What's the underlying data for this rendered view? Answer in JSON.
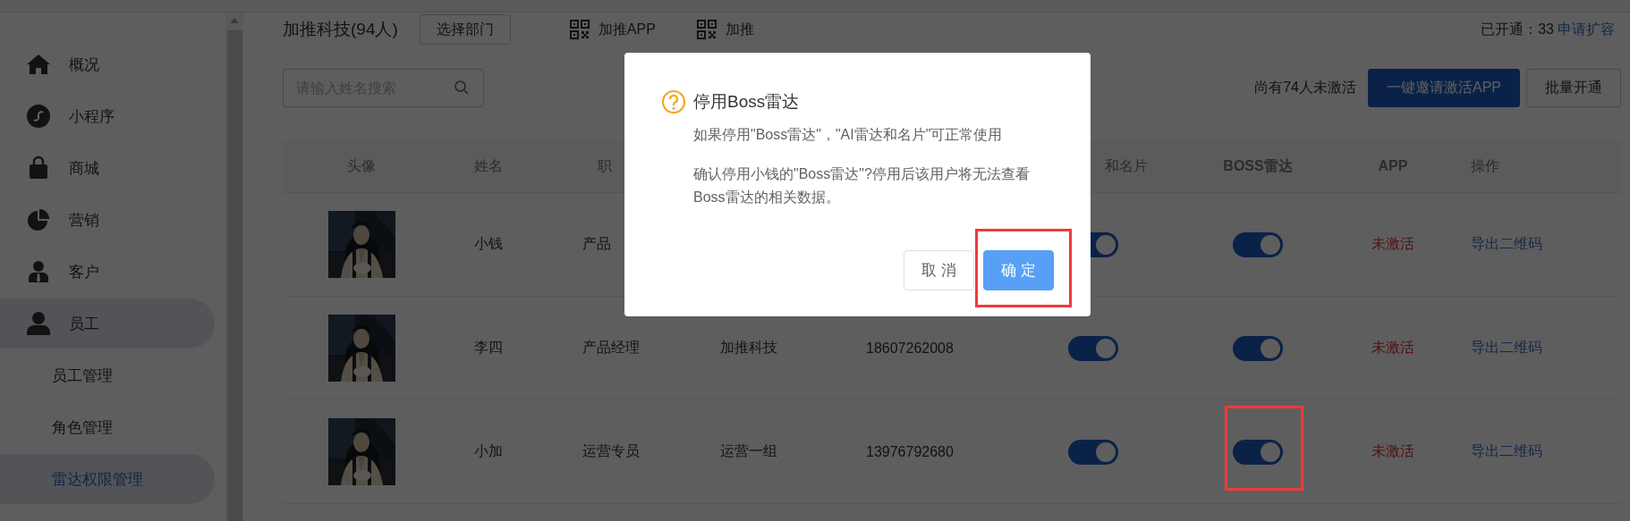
{
  "sidebar": {
    "items": [
      {
        "label": "概况",
        "expanded": false
      },
      {
        "label": "小程序",
        "expanded": false
      },
      {
        "label": "商城",
        "expanded": false
      },
      {
        "label": "营销",
        "expanded": false
      },
      {
        "label": "客户",
        "expanded": false
      },
      {
        "label": "员工",
        "expanded": true,
        "children": [
          {
            "label": "员工管理",
            "selected": false
          },
          {
            "label": "角色管理",
            "selected": false
          },
          {
            "label": "雷达权限管理",
            "selected": true
          }
        ]
      }
    ]
  },
  "header": {
    "company": "加推科技(94人)",
    "department_button": "选择部门",
    "qr_links": [
      "加推APP",
      "加推"
    ],
    "quota": "已开通：33",
    "quota_link": "申请扩容"
  },
  "toolbar": {
    "search": {
      "placeholder": "请输入姓名搜索"
    },
    "inactive_note": "尚有74人未激活",
    "buttons": [
      {
        "label": "一键邀请激活APP",
        "primary": true
      },
      {
        "label": "批量开通",
        "primary": false
      }
    ]
  },
  "table": {
    "columns": {
      "avatar": "头像",
      "name": "姓名",
      "column_3": "职",
      "column_6": "和名片",
      "boss_radar": "BOSS雷达",
      "app": "APP",
      "actions": "操作"
    },
    "rows": [
      {
        "name": "小钱",
        "column_3": "产品",
        "column_6_on": true,
        "boss_on": true,
        "boss_highlighted": false,
        "app": "未激活",
        "action": "导出二维码"
      },
      {
        "name": "李四",
        "column_3": "产品经理",
        "column_4": "加推科技",
        "column_5": "18607262008",
        "column_6_on": true,
        "boss_on": true,
        "boss_highlighted": false,
        "app": "未激活",
        "action": "导出二维码"
      },
      {
        "name": "小加",
        "column_3": "运营专员",
        "column_4": "运营一组",
        "column_5": "13976792680",
        "column_6_on": true,
        "boss_on": true,
        "boss_highlighted": true,
        "app": "未激活",
        "action": "导出二维码"
      }
    ]
  },
  "dialog": {
    "title": "停用Boss雷达",
    "message": "如果停用\"Boss雷达\"，\"AI雷达和名片\"可正常使用",
    "detail": "确认停用小钱的\"Boss雷达\"?停用后该用户将无法查看Boss雷达的相关数据。",
    "buttons": [
      {
        "label": "取 消",
        "primary": false,
        "highlighted": false
      },
      {
        "label": "确 定",
        "primary": true,
        "highlighted": true
      }
    ]
  }
}
